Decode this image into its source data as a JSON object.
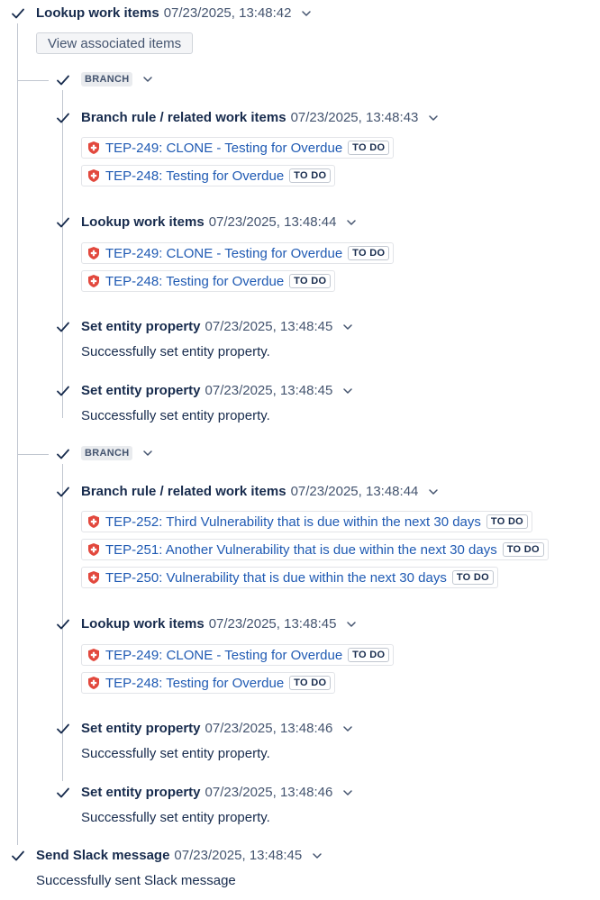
{
  "top_lookup": {
    "title": "Lookup work items",
    "timestamp": "07/23/2025, 13:48:42",
    "button_label": "View associated items"
  },
  "branch1": {
    "badge": "BRANCH",
    "rule": {
      "title": "Branch rule / related work items",
      "timestamp": "07/23/2025, 13:48:43",
      "items": [
        {
          "label": "TEP-249: CLONE - Testing for Overdue",
          "status": "TO DO"
        },
        {
          "label": "TEP-248: Testing for Overdue",
          "status": "TO DO"
        }
      ]
    },
    "lookup": {
      "title": "Lookup work items",
      "timestamp": "07/23/2025, 13:48:44",
      "items": [
        {
          "label": "TEP-249: CLONE - Testing for Overdue",
          "status": "TO DO"
        },
        {
          "label": "TEP-248: Testing for Overdue",
          "status": "TO DO"
        }
      ]
    },
    "prop1": {
      "title": "Set entity property",
      "timestamp": "07/23/2025, 13:48:45",
      "message": "Successfully set entity property."
    },
    "prop2": {
      "title": "Set entity property",
      "timestamp": "07/23/2025, 13:48:45",
      "message": "Successfully set entity property."
    }
  },
  "branch2": {
    "badge": "BRANCH",
    "rule": {
      "title": "Branch rule / related work items",
      "timestamp": "07/23/2025, 13:48:44",
      "items": [
        {
          "label": "TEP-252: Third Vulnerability that is due within the next 30 days",
          "status": "TO DO"
        },
        {
          "label": "TEP-251: Another Vulnerability that is due within the next 30 days",
          "status": "TO DO"
        },
        {
          "label": "TEP-250: Vulnerability that is due within the next 30 days",
          "status": "TO DO"
        }
      ]
    },
    "lookup": {
      "title": "Lookup work items",
      "timestamp": "07/23/2025, 13:48:45",
      "items": [
        {
          "label": "TEP-249: CLONE - Testing for Overdue",
          "status": "TO DO"
        },
        {
          "label": "TEP-248: Testing for Overdue",
          "status": "TO DO"
        }
      ]
    },
    "prop1": {
      "title": "Set entity property",
      "timestamp": "07/23/2025, 13:48:46",
      "message": "Successfully set entity property."
    },
    "prop2": {
      "title": "Set entity property",
      "timestamp": "07/23/2025, 13:48:46",
      "message": "Successfully set entity property."
    }
  },
  "slack": {
    "title": "Send Slack message",
    "timestamp": "07/23/2025, 13:48:45",
    "message": "Successfully sent Slack message"
  },
  "icons": {
    "check": "checkmark-icon",
    "chevron": "chevron-down-icon",
    "priority": "shield-priority-icon"
  },
  "colors": {
    "link": "#1f5ab3",
    "priority_red": "#e2483d",
    "line": "#c1c7d0"
  }
}
